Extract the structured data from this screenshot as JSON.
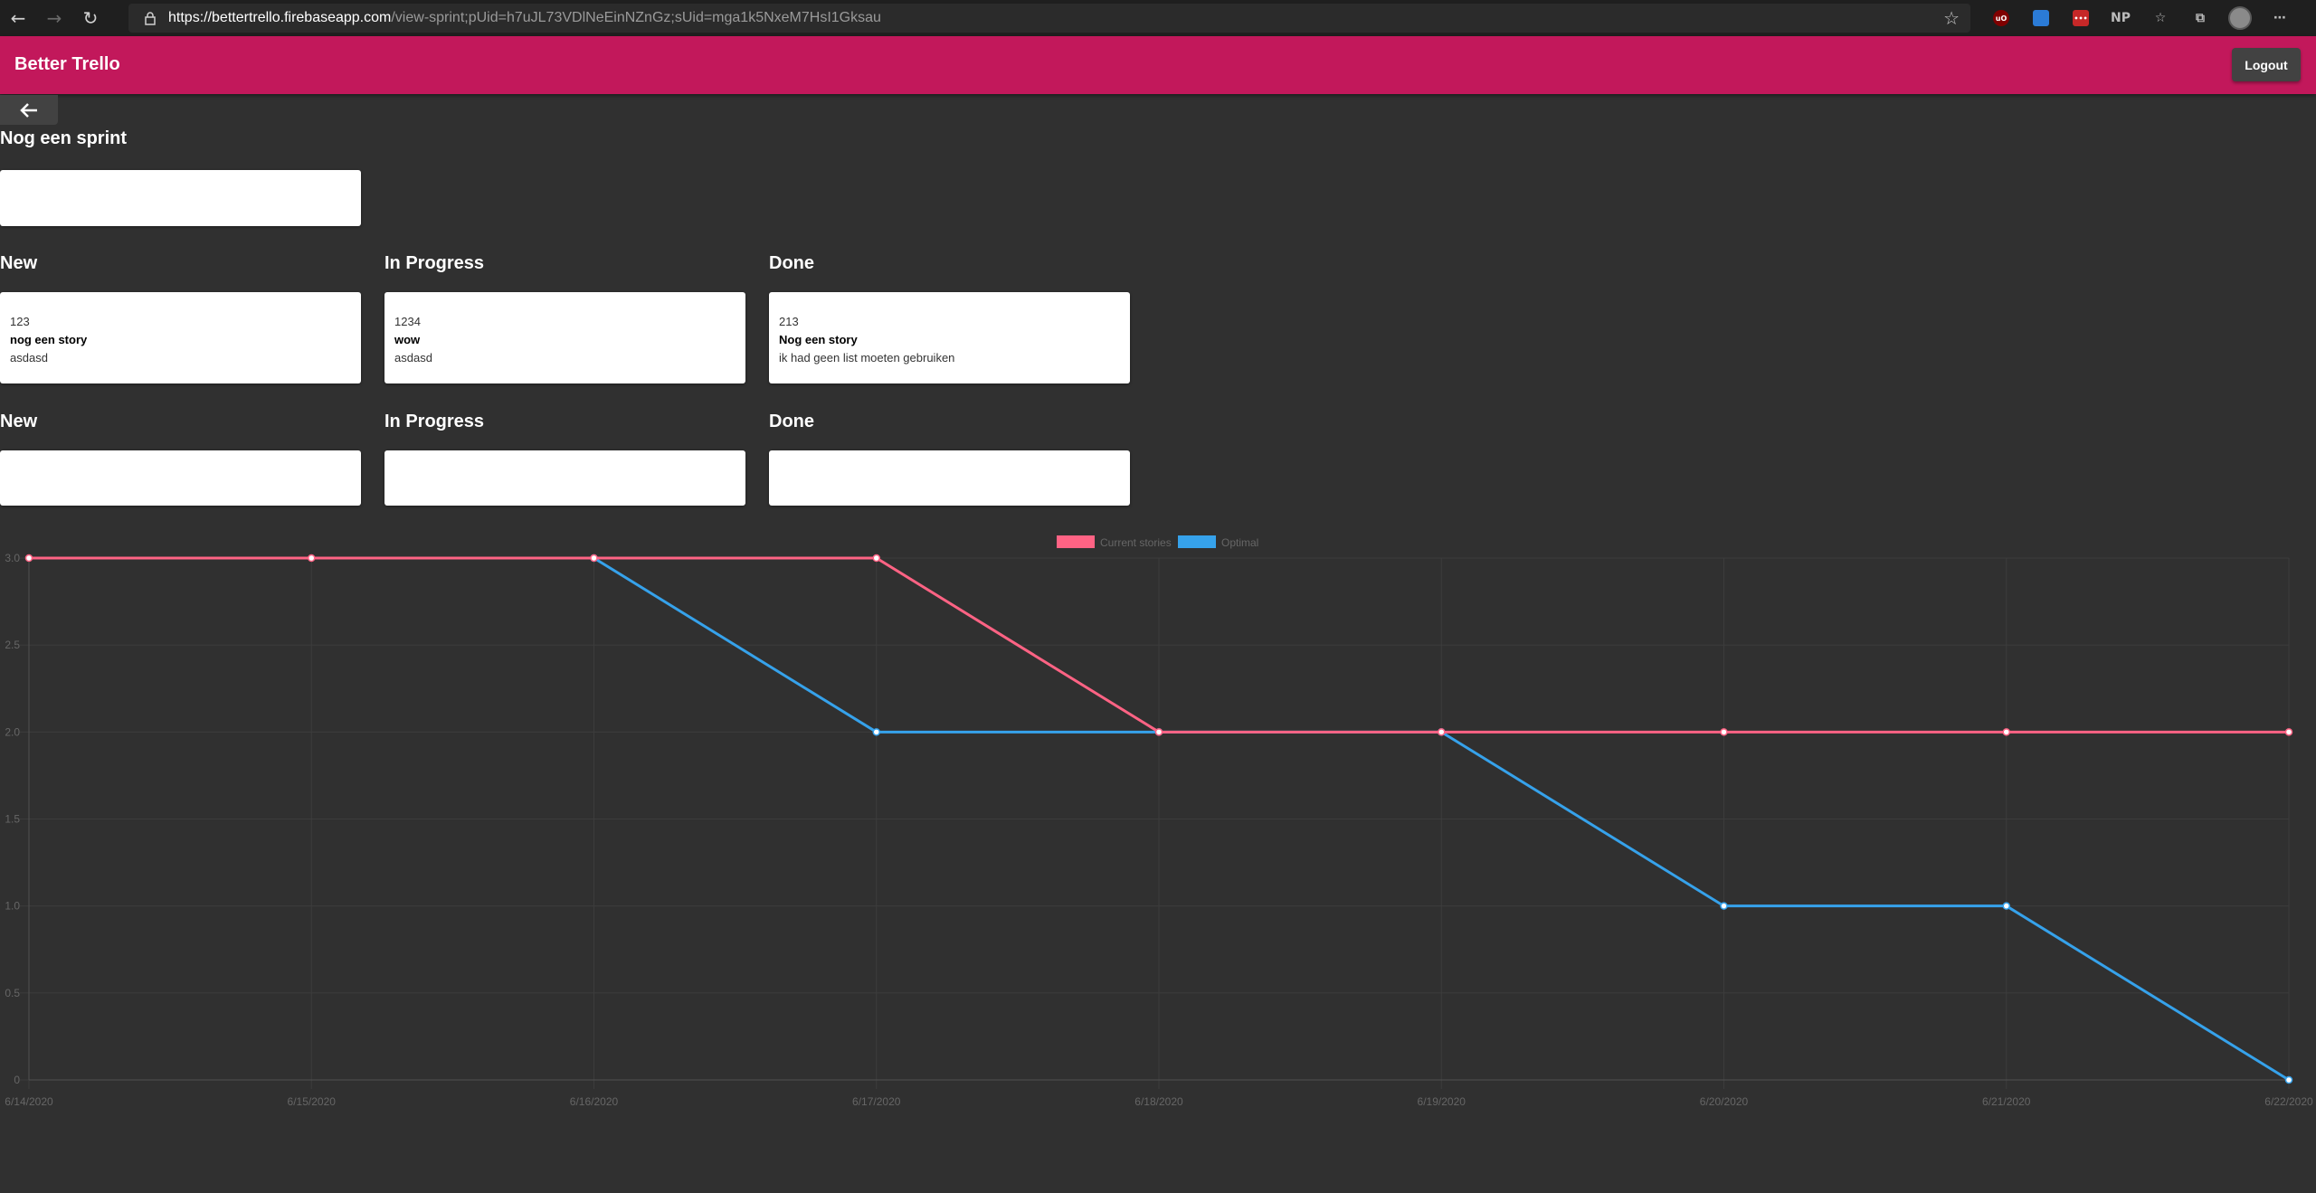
{
  "browser": {
    "url_host": "https://bettertrello.firebaseapp.com",
    "url_path": "/view-sprint;pUid=h7uJL73VDlNeEinNZnGz;sUid=mga1k5NxeM7HsI1Gksau",
    "extensions": [
      "uBlock",
      "extension-blue",
      "extension-red",
      "NP"
    ]
  },
  "app": {
    "title": "Better Trello",
    "logout_label": "Logout",
    "accent_color": "#c2185b"
  },
  "sprint": {
    "title": "Nog een sprint",
    "name_input_value": ""
  },
  "board": {
    "columns": [
      "New",
      "In Progress",
      "Done"
    ],
    "stories": [
      {
        "id": "123",
        "name": "nog een story",
        "description": "asdasd",
        "status": "New"
      },
      {
        "id": "1234",
        "name": "wow",
        "description": "asdasd",
        "status": "In Progress"
      },
      {
        "id": "213",
        "name": "Nog een story",
        "description": "ik had geen list moeten gebruiken",
        "status": "Done"
      }
    ]
  },
  "board2": {
    "columns": [
      "New",
      "In Progress",
      "Done"
    ]
  },
  "chart_data": {
    "type": "line",
    "x": [
      "6/14/2020",
      "6/15/2020",
      "6/16/2020",
      "6/17/2020",
      "6/18/2020",
      "6/19/2020",
      "6/20/2020",
      "6/21/2020",
      "6/22/2020"
    ],
    "ylim": [
      0,
      3
    ],
    "yticks": [
      "3.0",
      "2.5",
      "2.0",
      "1.5",
      "1.0",
      "0.5",
      "0"
    ],
    "legend_position": "top",
    "grid": true,
    "series": [
      {
        "name": "Current stories",
        "color": "#ff6384",
        "values": [
          3,
          3,
          3,
          3,
          2,
          2,
          2,
          2,
          2
        ]
      },
      {
        "name": "Optimal",
        "color": "#36a2eb",
        "values": [
          null,
          null,
          3,
          2,
          2,
          2,
          1,
          1,
          0
        ]
      }
    ]
  }
}
